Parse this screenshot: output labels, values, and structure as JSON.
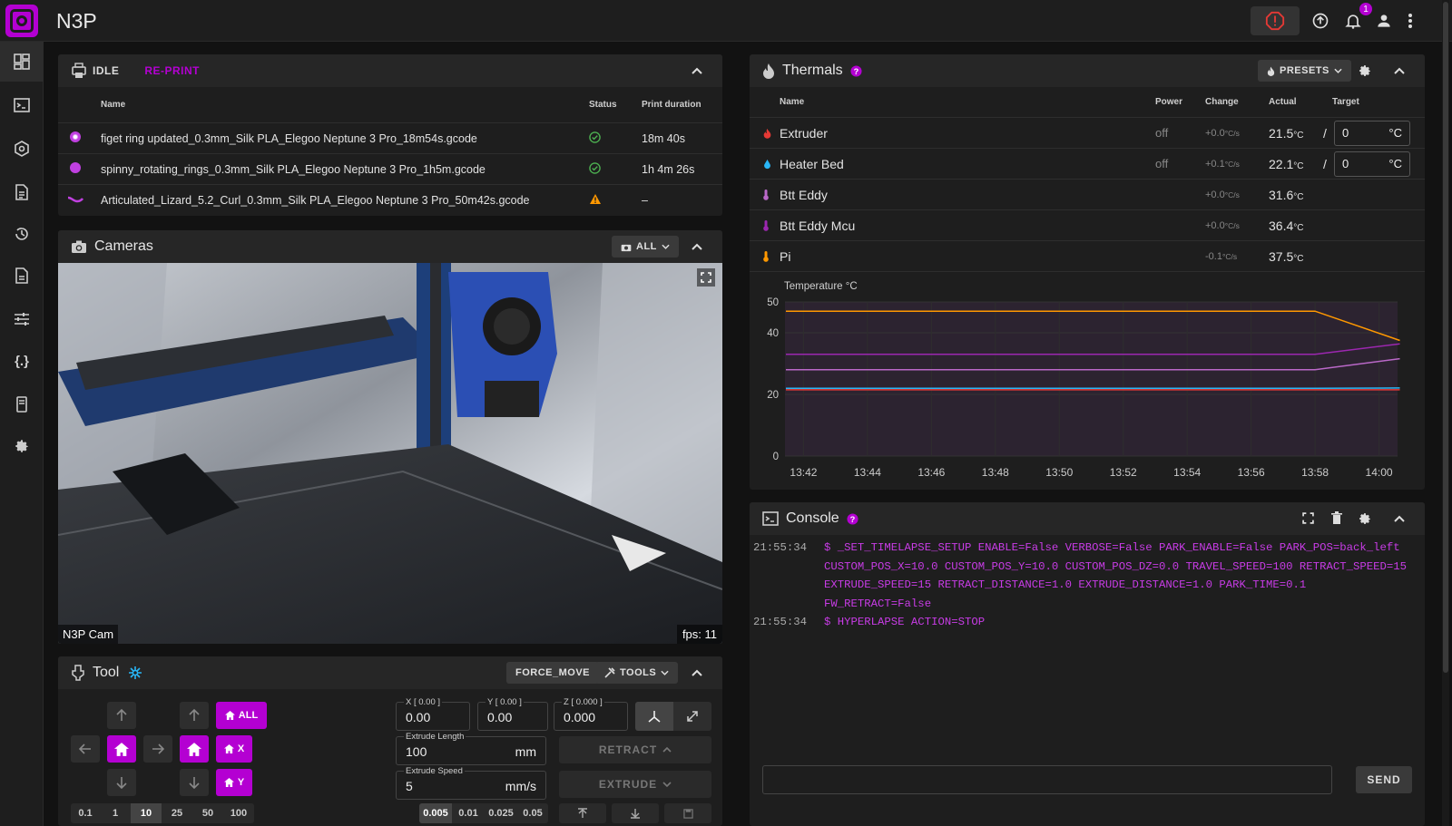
{
  "app": {
    "title": "N3P",
    "notifications_count": "1"
  },
  "colors": {
    "accent": "#b400d2",
    "bg": "#121212",
    "card": "#1e1e1e",
    "ok": "#4caf50",
    "warn": "#ff9800"
  },
  "topbar": {
    "icons": [
      "emergency-stop-icon",
      "upload-icon",
      "bell-icon",
      "account-icon",
      "more-vert-icon"
    ]
  },
  "sidebar": {
    "items": [
      "dashboard-icon",
      "console-icon",
      "heightmap-icon",
      "jobs-icon",
      "history-icon",
      "timelapse-icon",
      "tune-icon",
      "macros-icon",
      "system-icon",
      "settings-icon"
    ]
  },
  "job": {
    "status": "IDLE",
    "reprint": "RE-PRINT",
    "headers": {
      "name": "Name",
      "status": "Status",
      "duration": "Print duration"
    },
    "files": [
      {
        "name": "figet ring updated_0.3mm_Silk PLA_Elegoo Neptune 3 Pro_18m54s.gcode",
        "status": "ok",
        "duration": "18m 40s"
      },
      {
        "name": "spinny_rotating_rings_0.3mm_Silk PLA_Elegoo Neptune 3 Pro_1h5m.gcode",
        "status": "ok",
        "duration": "1h 4m 26s"
      },
      {
        "name": "Articulated_Lizard_5.2_Curl_0.3mm_Silk PLA_Elegoo Neptune 3 Pro_50m42s.gcode",
        "status": "warning",
        "duration": "–"
      }
    ]
  },
  "cameras": {
    "title": "Cameras",
    "filter": "ALL",
    "cam_name": "N3P Cam",
    "fps": "fps: 11"
  },
  "tool": {
    "title": "Tool",
    "force_move": "FORCE_MOVE",
    "tools": "TOOLS",
    "home_all": "ALL",
    "home_x": "X",
    "home_y": "Y",
    "x_label": "X [ 0.00 ]",
    "x_val": "0.00",
    "y_label": "Y [ 0.00 ]",
    "y_val": "0.00",
    "z_label": "Z [ 0.000 ]",
    "z_val": "0.000",
    "extrude_length_label": "Extrude Length",
    "extrude_length": "100",
    "extrude_length_unit": "mm",
    "extrude_speed_label": "Extrude Speed",
    "extrude_speed": "5",
    "extrude_speed_unit": "mm/s",
    "retract": "RETRACT",
    "extrude": "EXTRUDE",
    "steps": [
      "0.1",
      "1",
      "10",
      "25",
      "50",
      "100"
    ],
    "steps_selected": "10",
    "z_steps": [
      "0.005",
      "0.01",
      "0.025",
      "0.05"
    ],
    "z_steps_selected": "0.005"
  },
  "thermals": {
    "title": "Thermals",
    "presets": "PRESETS",
    "headers": {
      "name": "Name",
      "power": "Power",
      "change": "Change",
      "actual": "Actual",
      "target": "Target"
    },
    "rows": [
      {
        "name": "Extruder",
        "power": "off",
        "change": "+0.0",
        "actual": "21.5",
        "target": "0",
        "icon": "fire-icon"
      },
      {
        "name": "Heater Bed",
        "power": "off",
        "change": "+0.1",
        "actual": "22.1",
        "target": "0",
        "icon": "water-icon"
      },
      {
        "name": "Btt Eddy",
        "power": "",
        "change": "+0.0",
        "actual": "31.6",
        "target": "",
        "icon": "thermometer-icon"
      },
      {
        "name": "Btt Eddy Mcu",
        "power": "",
        "change": "+0.0",
        "actual": "36.4",
        "target": "",
        "icon": "thermometer-icon"
      },
      {
        "name": "Pi",
        "power": "",
        "change": "-0.1",
        "actual": "37.5",
        "target": "",
        "icon": "thermometer-icon"
      }
    ],
    "units": {
      "change": "°C/s",
      "actual": "°C",
      "target": "°C"
    }
  },
  "chart_data": {
    "type": "line",
    "title": "Temperature °C",
    "x": [
      "13:42",
      "13:44",
      "13:46",
      "13:48",
      "13:50",
      "13:52",
      "13:54",
      "13:56",
      "13:58",
      "14:00"
    ],
    "ylim": [
      0,
      50
    ],
    "yticks": [
      0,
      20,
      40,
      50
    ],
    "grid": true,
    "series": [
      {
        "color": "#ff9800",
        "values": [
          47,
          47,
          47,
          47,
          47,
          47,
          47,
          47,
          47,
          37.5
        ]
      },
      {
        "color": "#9c27b0",
        "values": [
          33,
          33,
          33,
          33,
          33,
          33,
          33,
          33,
          33,
          36.4
        ]
      },
      {
        "color": "#ba68c8",
        "values": [
          28,
          28,
          28,
          28,
          28,
          28,
          28,
          28,
          28,
          31.6
        ]
      },
      {
        "color": "#e53935",
        "values": [
          21.5,
          21.5,
          21.5,
          21.5,
          21.5,
          21.5,
          21.5,
          21.5,
          21.5,
          21.5
        ]
      },
      {
        "color": "#29b6f6",
        "values": [
          22,
          22,
          22,
          22,
          22,
          22,
          22,
          22,
          22,
          22.1
        ]
      }
    ]
  },
  "console": {
    "title": "Console",
    "send": "SEND",
    "lines": [
      {
        "time": "21:55:34",
        "text": "$ _SET_TIMELAPSE_SETUP  ENABLE=False VERBOSE=False PARK_ENABLE=False PARK_POS=back_left CUSTOM_POS_X=10.0 CUSTOM_POS_Y=10.0 CUSTOM_POS_DZ=0.0 TRAVEL_SPEED=100 RETRACT_SPEED=15 EXTRUDE_SPEED=15 RETRACT_DISTANCE=1.0 EXTRUDE_DISTANCE=1.0 PARK_TIME=0.1 FW_RETRACT=False"
      },
      {
        "time": "21:55:34",
        "text": "$ HYPERLAPSE ACTION=STOP"
      }
    ]
  }
}
